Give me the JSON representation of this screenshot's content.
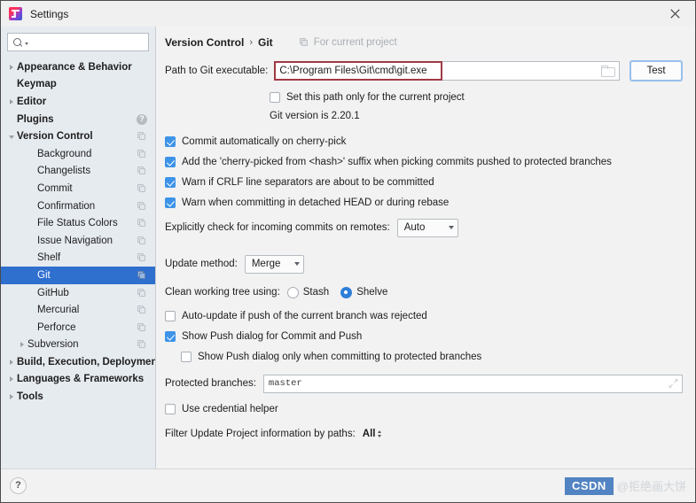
{
  "window": {
    "title": "Settings",
    "app_icon": "intellij-idea-icon",
    "close_label": "✕"
  },
  "sidebar": {
    "search": {
      "value": "",
      "placeholder": ""
    },
    "items": [
      {
        "label": "Appearance & Behavior",
        "level": 0,
        "bold": true,
        "twisty": "closed",
        "badge": "none",
        "selected": false
      },
      {
        "label": "Keymap",
        "level": 0,
        "bold": true,
        "twisty": "none",
        "badge": "none",
        "selected": false
      },
      {
        "label": "Editor",
        "level": 0,
        "bold": true,
        "twisty": "closed",
        "badge": "none",
        "selected": false
      },
      {
        "label": "Plugins",
        "level": 0,
        "bold": true,
        "twisty": "none",
        "badge": "help",
        "selected": false
      },
      {
        "label": "Version Control",
        "level": 0,
        "bold": true,
        "twisty": "open",
        "badge": "config",
        "selected": false
      },
      {
        "label": "Background",
        "level": 1,
        "bold": false,
        "twisty": "none",
        "badge": "config",
        "selected": false
      },
      {
        "label": "Changelists",
        "level": 1,
        "bold": false,
        "twisty": "none",
        "badge": "config",
        "selected": false
      },
      {
        "label": "Commit",
        "level": 1,
        "bold": false,
        "twisty": "none",
        "badge": "config",
        "selected": false
      },
      {
        "label": "Confirmation",
        "level": 1,
        "bold": false,
        "twisty": "none",
        "badge": "config",
        "selected": false
      },
      {
        "label": "File Status Colors",
        "level": 1,
        "bold": false,
        "twisty": "none",
        "badge": "config",
        "selected": false
      },
      {
        "label": "Issue Navigation",
        "level": 1,
        "bold": false,
        "twisty": "none",
        "badge": "config",
        "selected": false
      },
      {
        "label": "Shelf",
        "level": 1,
        "bold": false,
        "twisty": "none",
        "badge": "config",
        "selected": false
      },
      {
        "label": "Git",
        "level": 1,
        "bold": false,
        "twisty": "none",
        "badge": "config",
        "selected": true
      },
      {
        "label": "GitHub",
        "level": 1,
        "bold": false,
        "twisty": "none",
        "badge": "config",
        "selected": false
      },
      {
        "label": "Mercurial",
        "level": 1,
        "bold": false,
        "twisty": "none",
        "badge": "config",
        "selected": false
      },
      {
        "label": "Perforce",
        "level": 1,
        "bold": false,
        "twisty": "none",
        "badge": "config",
        "selected": false
      },
      {
        "label": "Subversion",
        "level": 1,
        "bold": false,
        "twisty": "closed",
        "badge": "config",
        "selected": false
      },
      {
        "label": "Build, Execution, Deployment",
        "level": 0,
        "bold": true,
        "twisty": "closed",
        "badge": "none",
        "selected": false
      },
      {
        "label": "Languages & Frameworks",
        "level": 0,
        "bold": true,
        "twisty": "closed",
        "badge": "none",
        "selected": false
      },
      {
        "label": "Tools",
        "level": 0,
        "bold": true,
        "twisty": "closed",
        "badge": "none",
        "selected": false
      }
    ]
  },
  "content": {
    "breadcrumb": {
      "root": "Version Control",
      "separator": "›",
      "current": "Git",
      "scope_label": "For current project"
    },
    "path_row": {
      "label": "Path to Git executable:",
      "value": "C:\\Program Files\\Git\\cmd\\git.exe",
      "highlight_color": "#a03a46",
      "browse_icon": "folder-icon",
      "test_button": "Test"
    },
    "set_path_project": {
      "label": "Set this path only for the current project",
      "checked": false
    },
    "git_version": "Git version is 2.20.1",
    "checkboxes": [
      {
        "label": "Commit automatically on cherry-pick",
        "checked": true
      },
      {
        "label": "Add the 'cherry-picked from <hash>' suffix when picking commits pushed to protected branches",
        "checked": true
      },
      {
        "label": "Warn if CRLF line separators are about to be committed",
        "checked": true
      },
      {
        "label": "Warn when committing in detached HEAD or during rebase",
        "checked": true
      }
    ],
    "incoming": {
      "label": "Explicitly check for incoming commits on remotes:",
      "value": "Auto"
    },
    "update_method": {
      "label": "Update method:",
      "value": "Merge"
    },
    "clean_tree": {
      "label": "Clean working tree using:",
      "options": [
        {
          "label": "Stash",
          "selected": false
        },
        {
          "label": "Shelve",
          "selected": true
        }
      ]
    },
    "auto_update": {
      "label": "Auto-update if push of the current branch was rejected",
      "checked": false
    },
    "show_push": {
      "label": "Show Push dialog for Commit and Push",
      "checked": true
    },
    "show_push_protected": {
      "label": "Show Push dialog only when committing to protected branches",
      "checked": false
    },
    "protected_branches": {
      "label": "Protected branches:",
      "value": "master",
      "expand_icon": "expand-arrows-icon"
    },
    "credential_helper": {
      "label": "Use credential helper",
      "checked": false
    },
    "filter_paths": {
      "label": "Filter Update Project information by paths:",
      "value": "All"
    }
  },
  "footer": {
    "help_label": "?",
    "watermark_brand": "CSDN",
    "watermark_user": "@拒绝画大饼"
  }
}
